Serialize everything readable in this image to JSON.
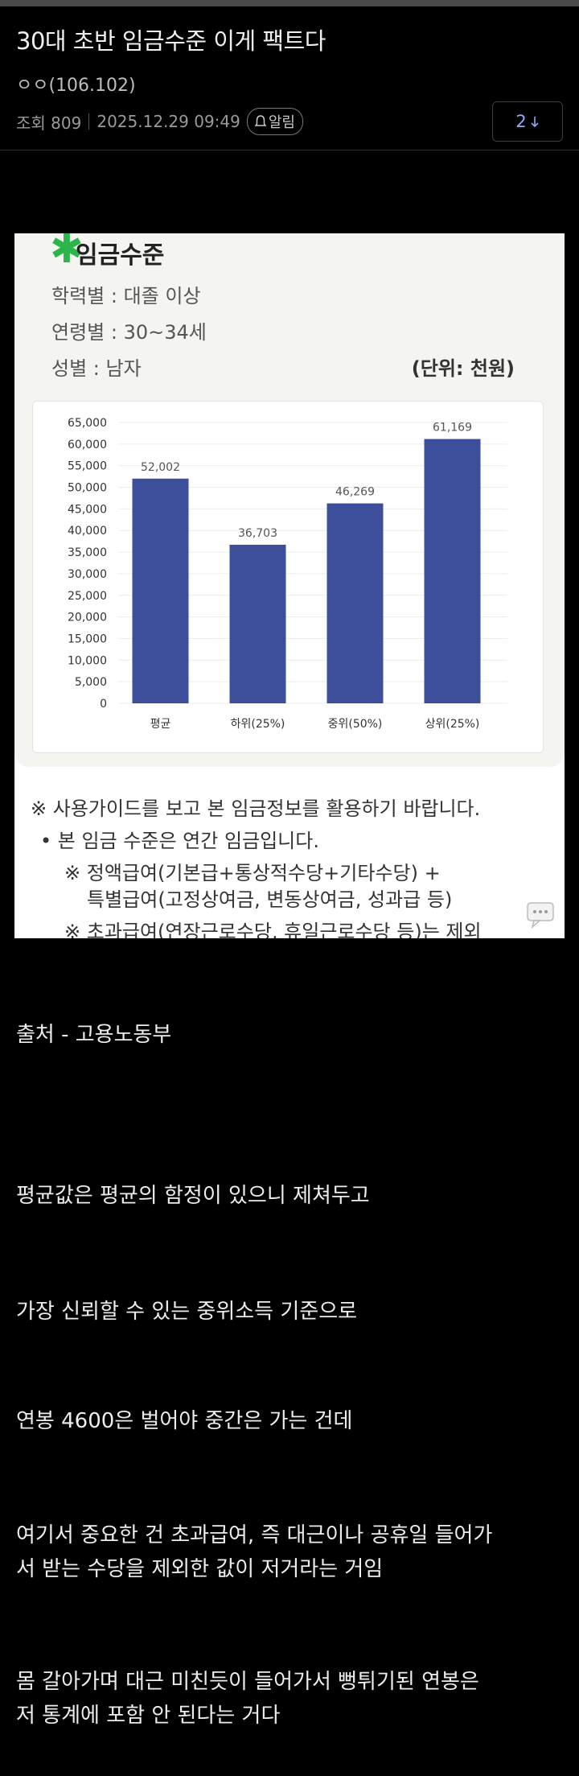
{
  "post": {
    "title": "30대 초반 임금수준 이게 팩트다",
    "author": "ㅇㅇ(106.102)",
    "views": "조회 809",
    "date": "2025.12.29 09:49",
    "alarm_label": "알림",
    "comment_count": "2"
  },
  "image": {
    "title": "임금수준",
    "education": "학력별 : 대졸 이상",
    "age": "연령별 : 30~34세",
    "gender": "성별 : 남자",
    "unit": "(단위: 천원)",
    "notes": [
      "※ 사용가이드를 보고 본 임금정보를 활용하기 바랍니다.",
      "•  본 임금 수준은 연간 임금입니다.",
      "※ 정액급여(기본급+통상적수당+기타수당) +",
      "특별급여(고정상여금, 변동상여금, 성과급 등)",
      "※ 초과급여(연장근로수당, 휴일근로수당 등)는 제외"
    ]
  },
  "chart_data": {
    "type": "bar",
    "categories": [
      "평균",
      "하위(25%)",
      "중위(50%)",
      "상위(25%)"
    ],
    "values": [
      52002,
      36703,
      46269,
      61169
    ],
    "data_labels": [
      "52,002",
      "36,703",
      "46,269",
      "61,169"
    ],
    "yticks": [
      "0",
      "5,000",
      "10,000",
      "15,000",
      "20,000",
      "25,000",
      "30,000",
      "35,000",
      "40,000",
      "45,000",
      "50,000",
      "55,000",
      "60,000",
      "65,000"
    ],
    "ylim": [
      0,
      65000
    ],
    "bar_color": "#3d4f9a",
    "grid": true
  },
  "content": {
    "source": "출처 - 고용노동부",
    "p1": "평균값은 평균의 함정이 있으니 제쳐두고",
    "p2": "가장 신뢰할 수 있는 중위소득 기준으로",
    "p3": "연봉 4600은 벌어야 중간은 가는 건데",
    "p4_line1": "여기서 중요한 건 초과급여, 즉 대근이나 공휴일 들어가",
    "p4_line2": "서 받는 수당을 제외한 값이 저거라는 거임",
    "p5_line1": "몸 갈아가며 대근 미친듯이 들어가서 뻥튀기된 연봉은",
    "p5_line2": "저 통계에 포함 안 된다는 거다"
  },
  "icons": {
    "alarm": "bell-icon",
    "comment_arrow": "arrow-down-icon",
    "float": "comment-bubble-icon"
  }
}
